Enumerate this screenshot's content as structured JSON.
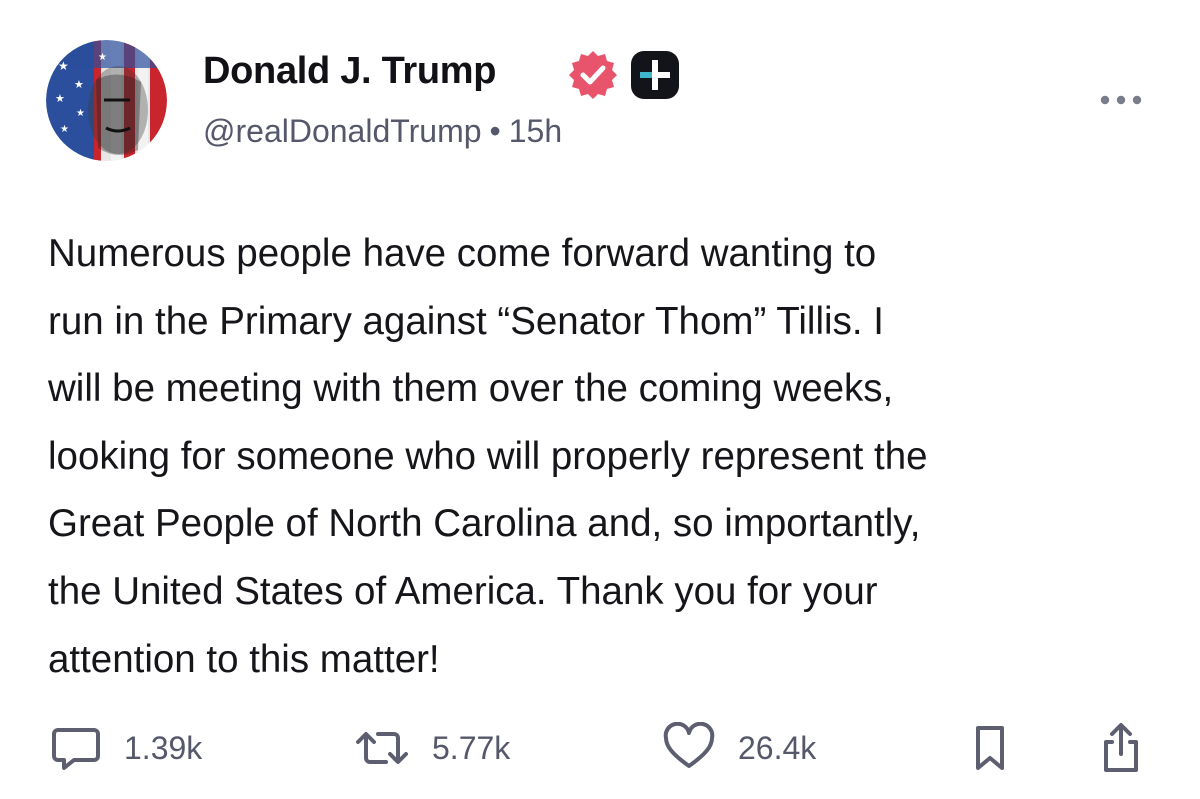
{
  "post": {
    "author": {
      "display_name": "Donald J. Trump",
      "handle": "@realDonaldTrump",
      "separator": "•",
      "time_ago": "15h",
      "verified_badge_color": "#e8546b",
      "plus_badge_color": "#13131a"
    },
    "text_lines": [
      "Numerous people have come forward wanting to",
      "run in the Primary against “Senator Thom” Tillis. I",
      "will be meeting with them over the coming weeks,",
      "looking for someone who will properly represent the",
      "Great People of North Carolina and, so importantly,",
      "the United States of America. Thank you for your",
      "attention to this matter!"
    ],
    "actions": {
      "replies": {
        "icon": "comment-icon",
        "count": "1.39k"
      },
      "reposts": {
        "icon": "repost-icon",
        "count": "5.77k"
      },
      "likes": {
        "icon": "heart-icon",
        "count": "26.4k"
      },
      "bookmark": {
        "icon": "bookmark-icon"
      },
      "share": {
        "icon": "share-icon"
      }
    },
    "colors": {
      "text": "#15151a",
      "muted": "#55576a",
      "icon": "#5d5f70"
    }
  }
}
